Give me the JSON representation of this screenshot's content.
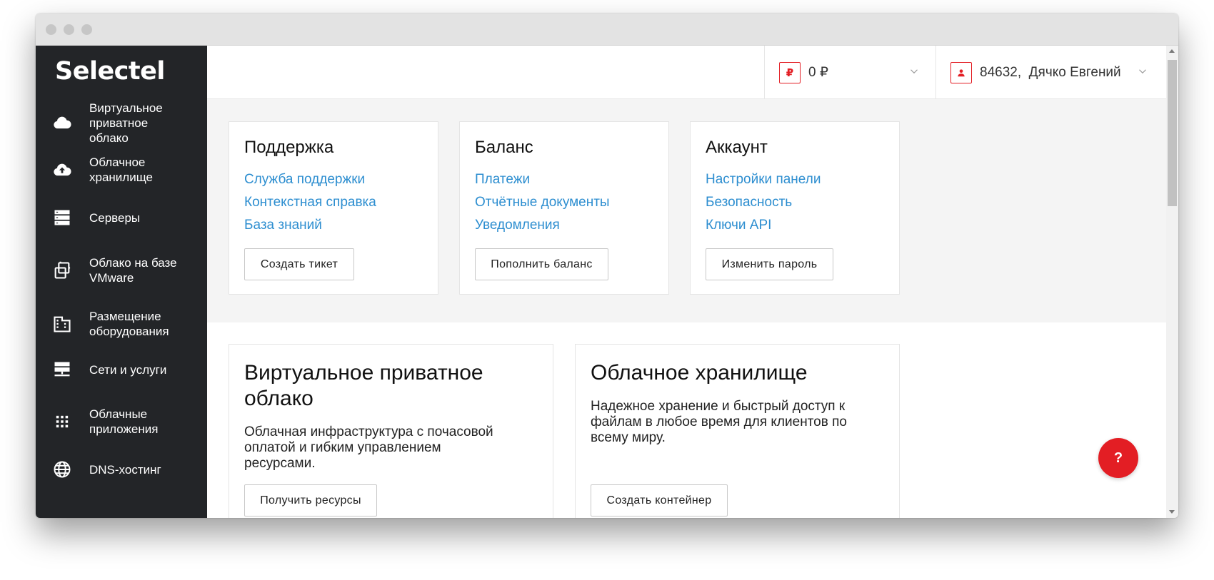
{
  "brand": {
    "logo": "Selectel"
  },
  "sidebar": {
    "items": [
      {
        "label": "Виртуальное приватное облако",
        "icon": "cloud-icon"
      },
      {
        "label": "Облачное хранилище",
        "icon": "cloud-upload-icon"
      },
      {
        "label": "Серверы",
        "icon": "server-icon"
      },
      {
        "label": "Облако на базе VMware",
        "icon": "vmware-icon"
      },
      {
        "label": "Размещение оборудования",
        "icon": "building-icon"
      },
      {
        "label": "Сети и услуги",
        "icon": "network-icon"
      },
      {
        "label": "Облачные приложения",
        "icon": "apps-grid-icon"
      },
      {
        "label": "DNS-хостинг",
        "icon": "globe-icon"
      }
    ]
  },
  "header": {
    "balance": {
      "currency_badge": "₽",
      "amount": "0 ₽"
    },
    "user": {
      "account": "84632,  Дячко Евгений"
    }
  },
  "cards": {
    "support": {
      "title": "Поддержка",
      "links": [
        "Служба поддержки",
        "Контекстная справка",
        "База знаний"
      ],
      "button": "Создать тикет"
    },
    "balance": {
      "title": "Баланс",
      "links": [
        "Платежи",
        "Отчётные документы",
        "Уведомления"
      ],
      "button": "Пополнить баланс"
    },
    "account": {
      "title": "Аккаунт",
      "links": [
        "Настройки панели",
        "Безопасность",
        "Ключи API"
      ],
      "button": "Изменить пароль"
    }
  },
  "services": {
    "vpc": {
      "title": "Виртуальное приватное облако",
      "description": "Облачная инфраструктура с почасовой оплатой и гибким управлением ресурсами.",
      "button": "Получить ресурсы"
    },
    "storage": {
      "title": "Облачное хранилище",
      "description": "Надежное хранение и быстрый доступ к файлам в любое время для клиентов по всему миру.",
      "button": "Создать контейнер"
    }
  },
  "help": {
    "label": "?"
  },
  "colors": {
    "sidebar_bg": "#232528",
    "accent_red": "#e31e24",
    "link_blue": "#2d8ed0",
    "grey_bg": "#f4f4f4"
  }
}
